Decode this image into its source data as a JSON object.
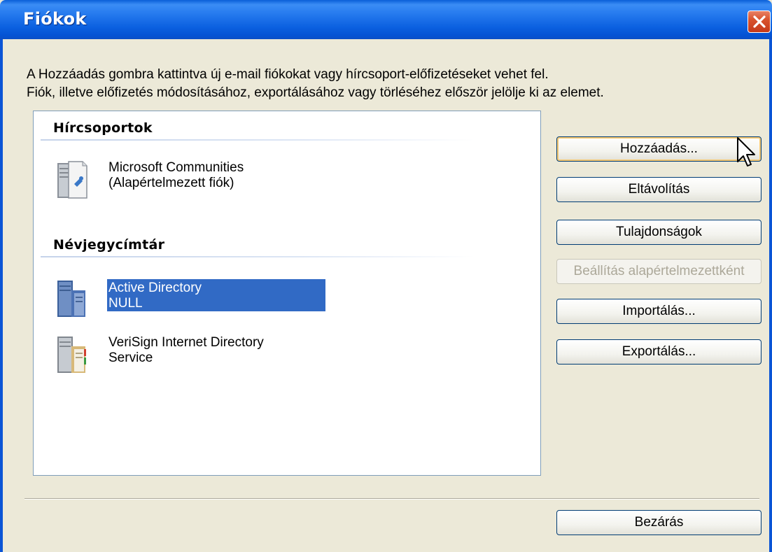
{
  "window": {
    "title": "Fiókok"
  },
  "description": {
    "line1": "A Hozzáadás gombra kattintva új e-mail fiókokat vagy hírcsoport-előfizetéseket vehet fel.",
    "line2": "Fiók, illetve előfizetés módosításához, exportálásához vagy törléséhez először jelölje ki az elemet."
  },
  "list": {
    "groups": [
      {
        "header": "Hírcsoportok",
        "items": [
          {
            "line1": "Microsoft Communities",
            "line2": "(Alapértelmezett fiók)",
            "icon": "newsgroup-server-icon",
            "selected": false
          }
        ]
      },
      {
        "header": "Névjegycímtár",
        "items": [
          {
            "line1": "Active Directory",
            "line2": "NULL",
            "icon": "directory-server-icon",
            "selected": true
          },
          {
            "line1": "VeriSign Internet Directory",
            "line2": "Service",
            "icon": "directory-server-icon",
            "selected": false
          }
        ]
      }
    ]
  },
  "buttons": {
    "add": "Hozzáadás...",
    "remove": "Eltávolítás",
    "properties": "Tulajdonságok",
    "set_default": "Beállítás alapértelmezettként",
    "import": "Importálás...",
    "export": "Exportálás...",
    "close": "Bezárás"
  },
  "colors": {
    "titlebar": "#0b5fe0",
    "selection": "#316ac5",
    "dialog_bg": "#ece9d8",
    "close_button": "#d8532e"
  }
}
